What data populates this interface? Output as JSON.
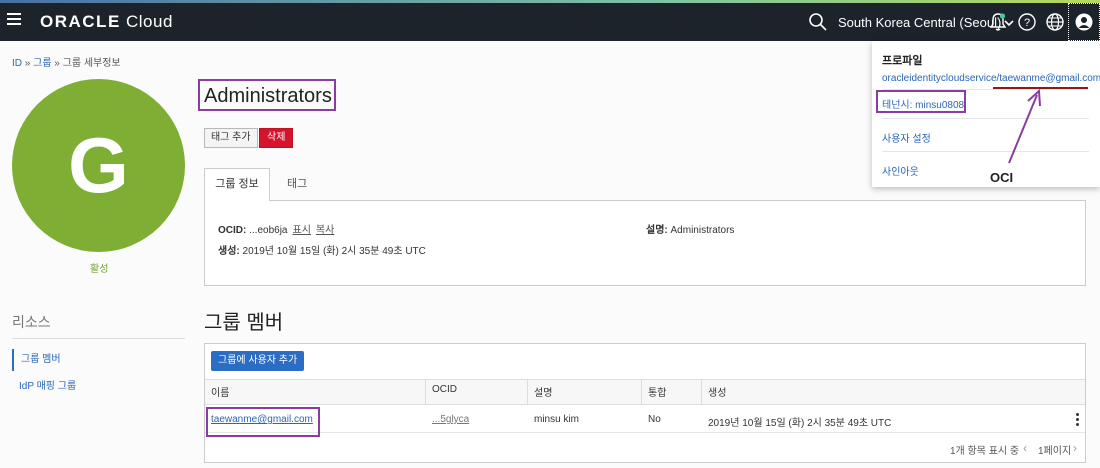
{
  "topbar": {
    "logo_brand": "ORACLE",
    "logo_product": " Cloud",
    "region": "South Korea Central (Seoul)"
  },
  "breadcrumb": {
    "root": "ID",
    "sep1": " » ",
    "groups": "그룹",
    "sep2": " » ",
    "current": "그룹 세부정보"
  },
  "group": {
    "avatar_letter": "G",
    "status": "활성",
    "name": "Administrators",
    "add_tag_label": "태그 추가",
    "delete_label": "삭제"
  },
  "tabs": {
    "info": "그룹 정보",
    "tags": "태그"
  },
  "info": {
    "ocid_label": "OCID:",
    "ocid_value": " ...eob6ja",
    "show_link": "표시",
    "copy_link": "복사",
    "desc_label": "설명:",
    "desc_value": " Administrators",
    "created_label": "생성:",
    "created_value": " 2019년 10월 15일 (화) 2시 35분 49초 UTC"
  },
  "resources": {
    "title": "리소스",
    "items": [
      "그룹 멤버",
      "IdP 매핑 그룹"
    ]
  },
  "members": {
    "heading": "그룹 멤버",
    "add_button": "그룹에 사용자 추가",
    "columns": [
      "이름",
      "OCID",
      "설명",
      "통합",
      "생성"
    ],
    "rows": [
      {
        "name": "taewanme@gmail.com",
        "ocid": "...5glyca",
        "description": "minsu kim",
        "federated": "No",
        "created": "2019년 10월 15일 (화) 2시 35분 49초 UTC"
      }
    ],
    "count_text": "1개 항목 표시 중",
    "page_text": "1페이지"
  },
  "profile_menu": {
    "title": "프로파일",
    "user": "oracleidentitycloudservice/taewanme@gmail.com",
    "tenancy": "테넌시: minsu0808",
    "settings": "사용자 설정",
    "signout": "사인아웃"
  },
  "annotation": {
    "label": "OCI"
  },
  "colors": {
    "topbar": "#1c232b",
    "avatar": "#7fae34",
    "accent": "#2b6cc4",
    "danger": "#d5132c",
    "highlight": "#8a3d9e"
  }
}
